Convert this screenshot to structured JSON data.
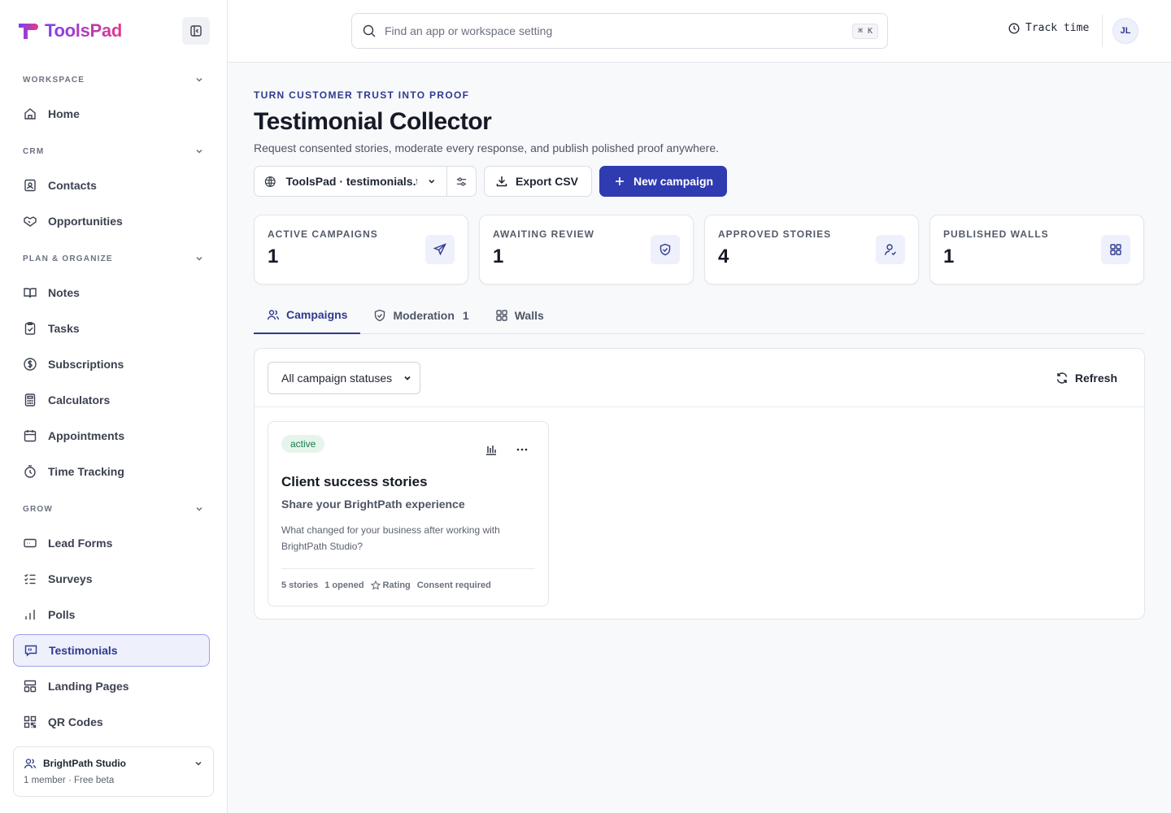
{
  "app": {
    "name": "ToolsPad"
  },
  "sidebar": {
    "sections": [
      {
        "label": "WORKSPACE",
        "items": [
          {
            "label": "Home",
            "icon": "home-icon"
          }
        ]
      },
      {
        "label": "CRM",
        "items": [
          {
            "label": "Contacts",
            "icon": "contacts-icon"
          },
          {
            "label": "Opportunities",
            "icon": "handshake-icon"
          }
        ]
      },
      {
        "label": "PLAN & ORGANIZE",
        "items": [
          {
            "label": "Notes",
            "icon": "book-icon"
          },
          {
            "label": "Tasks",
            "icon": "clipboard-check-icon"
          },
          {
            "label": "Subscriptions",
            "icon": "dollar-icon"
          },
          {
            "label": "Calculators",
            "icon": "calculator-icon"
          },
          {
            "label": "Appointments",
            "icon": "calendar-icon"
          },
          {
            "label": "Time Tracking",
            "icon": "stopwatch-icon"
          }
        ]
      },
      {
        "label": "GROW",
        "items": [
          {
            "label": "Lead Forms",
            "icon": "form-icon"
          },
          {
            "label": "Surveys",
            "icon": "checklist-icon"
          },
          {
            "label": "Polls",
            "icon": "bar-chart-icon"
          },
          {
            "label": "Testimonials",
            "icon": "message-quote-icon",
            "active": true
          },
          {
            "label": "Landing Pages",
            "icon": "layout-icon"
          },
          {
            "label": "QR Codes",
            "icon": "qr-code-icon"
          }
        ]
      }
    ],
    "org": {
      "name": "BrightPath Studio",
      "meta": "1 member · Free beta"
    }
  },
  "topbar": {
    "search_placeholder": "Find an app or workspace setting",
    "shortcut": "⌘ K",
    "track_time": "Track time",
    "avatar_initials": "JL"
  },
  "page": {
    "eyebrow": "TURN CUSTOMER TRUST INTO PROOF",
    "title": "Testimonial Collector",
    "subtitle": "Request consented stories, moderate every response, and publish polished proof anywhere.",
    "site_selector": "ToolsPad · testimonials.tc",
    "export_label": "Export CSV",
    "new_campaign_label": "New campaign"
  },
  "stats": [
    {
      "label": "ACTIVE CAMPAIGNS",
      "value": "1",
      "icon": "send-icon"
    },
    {
      "label": "AWAITING REVIEW",
      "value": "1",
      "icon": "shield-check-icon"
    },
    {
      "label": "APPROVED STORIES",
      "value": "4",
      "icon": "user-check-icon"
    },
    {
      "label": "PUBLISHED WALLS",
      "value": "1",
      "icon": "grid-icon"
    }
  ],
  "tabs": [
    {
      "label": "Campaigns",
      "active": true
    },
    {
      "label": "Moderation",
      "count": "1"
    },
    {
      "label": "Walls"
    }
  ],
  "filter": {
    "status_select": "All campaign statuses",
    "refresh_label": "Refresh"
  },
  "campaign": {
    "status": "active",
    "title": "Client success stories",
    "subtitle": "Share your BrightPath experience",
    "question": "What changed for your business after working with BrightPath Studio?",
    "stories": "5 stories",
    "opened": "1 opened",
    "rating": "Rating",
    "consent": "Consent required"
  },
  "colors": {
    "accent": "#2f3bb0",
    "active_badge": "#1a7a4a"
  }
}
